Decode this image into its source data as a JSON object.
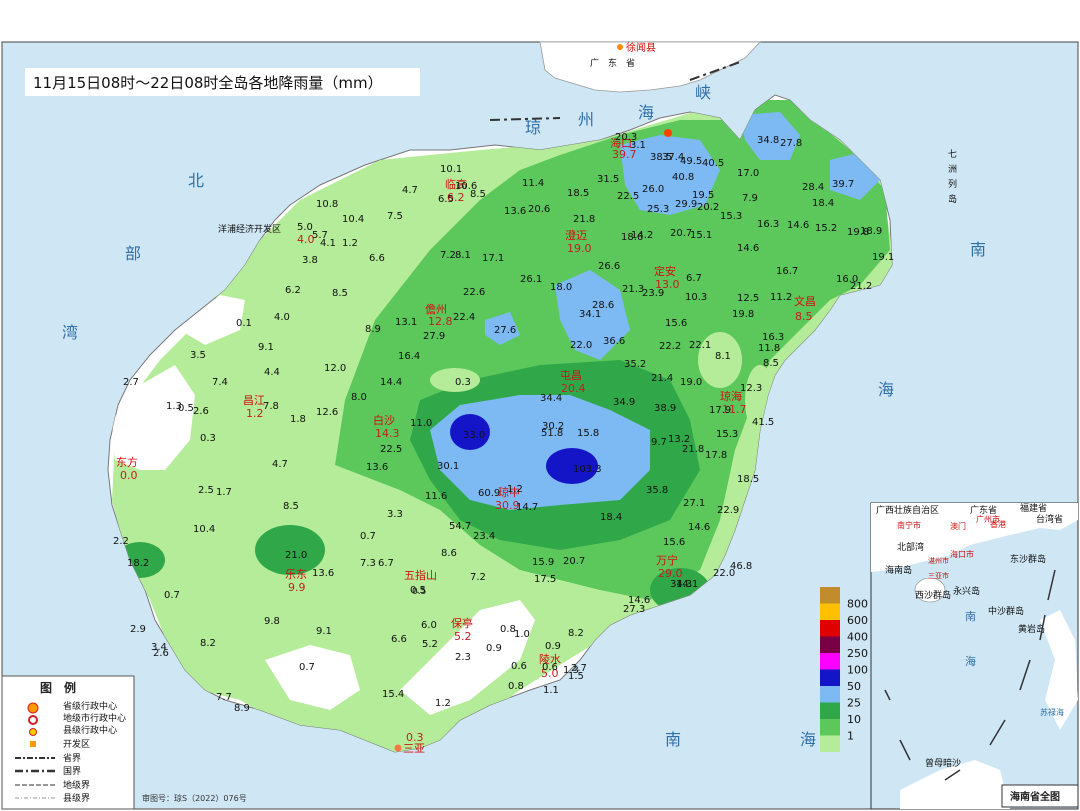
{
  "title": "11月15日08时～22日08时全岛各地降雨量（mm）",
  "colors": {
    "sea": "#cfe6f4",
    "land_outer": "#ffffff",
    "c1": "#b5ec99",
    "c10": "#5cc85c",
    "c25": "#30a84a",
    "c50": "#7db9f3",
    "c100": "#1515c8",
    "c250": "#ff00ff",
    "c400": "#7a0045",
    "c600": "#e00000",
    "c800": "#ffc000",
    "c_top": "#c08c2c"
  },
  "sea_labels": {
    "north_chars": [
      "北",
      "部",
      "湾"
    ],
    "strait_chars": [
      "琼",
      "州",
      "海",
      "峡"
    ],
    "south_chars": [
      "南",
      "海"
    ],
    "east_chars": [
      "南",
      "海"
    ],
    "qizhou": [
      "七",
      "洲",
      "列",
      "岛"
    ],
    "guangdong": "广　东　省"
  },
  "places": {
    "xuwen": "徐闻县",
    "haikou": {
      "name": "海口",
      "value": "39.7"
    },
    "lingao": {
      "name": "临高",
      "value": "6.2"
    },
    "chengmai": {
      "name": "澄迈",
      "value": "19.0"
    },
    "dingan": {
      "name": "定安",
      "value": "13.0"
    },
    "wenchang": {
      "name": "文昌",
      "value": "8.5"
    },
    "danzhou": {
      "name": "儋州",
      "value": "12.8"
    },
    "yangpu": {
      "name": "洋浦经济开发区",
      "value": "4.0"
    },
    "changjiang": {
      "name": "昌江",
      "value": "1.2"
    },
    "baisha": {
      "name": "白沙",
      "value": "14.3"
    },
    "tunchang": {
      "name": "屯昌",
      "value": "20.4"
    },
    "qionghai": {
      "name": "琼海",
      "value": "11.7"
    },
    "dongfang": {
      "name": "东方",
      "value": "0.0"
    },
    "qiongzhong": {
      "name": "琼中",
      "value": "30.9"
    },
    "ledong": {
      "name": "乐东",
      "value": "9.9"
    },
    "wuzhishan": {
      "name": "五指山",
      "value": "0.5"
    },
    "baoting": {
      "name": "保亭",
      "value": "5.2"
    },
    "wanning": {
      "name": "万宁",
      "value": "29.0"
    },
    "lingshui": {
      "name": "陵水",
      "value": "5.0"
    },
    "sanya": {
      "name": "三亚",
      "value": "0.3"
    }
  },
  "station_values": [
    "20.3",
    "3.1",
    "38.5",
    "37.4",
    "49.5",
    "40.5",
    "34.8",
    "27.8",
    "28.4",
    "39.7",
    "10.1",
    "10.6",
    "6.5",
    "8.5",
    "4.7",
    "11.4",
    "18.5",
    "31.5",
    "26.0",
    "40.8",
    "19.5",
    "17.0",
    "18.4",
    "10.8",
    "10.4",
    "7.5",
    "13.6",
    "20.6",
    "21.8",
    "22.5",
    "25.3",
    "29.9",
    "20.2",
    "15.3",
    "7.9",
    "16.3",
    "14.6",
    "15.2",
    "19.8",
    "18.9",
    "19.1",
    "5.0",
    "5.7",
    "4.1",
    "1.2",
    "3.8",
    "6.6",
    "7.2",
    "8.1",
    "17.1",
    "18.6",
    "14.2",
    "20.7",
    "15.1",
    "14.6",
    "26.1",
    "18.0",
    "26.6",
    "21.3",
    "23.9",
    "6.7",
    "16.7",
    "16.0",
    "21.2",
    "6.2",
    "8.5",
    "22.6",
    "10.3",
    "12.5",
    "11.2",
    "0.1",
    "4.0",
    "13.1",
    "22.4",
    "27.6",
    "28.6",
    "34.1",
    "15.6",
    "19.8",
    "9.1",
    "8.9",
    "27.9",
    "22.0",
    "36.6",
    "22.2",
    "22.1",
    "11.8",
    "16.3",
    "3.5",
    "16.4",
    "35.2",
    "8.1",
    "8.5",
    "7.4",
    "4.4",
    "12.0",
    "14.4",
    "0.3",
    "21.4",
    "19.0",
    "12.3",
    "2.7",
    "7.8",
    "8.0",
    "34.4",
    "34.9",
    "17.9",
    "41.5",
    "1.3",
    "0.5",
    "2.6",
    "0.3",
    "1.8",
    "12.6",
    "11.0",
    "33.0",
    "30.2",
    "51.8",
    "15.8",
    "38.9",
    "15.3",
    "22.5",
    "9.7",
    "13.2",
    "21.8",
    "17.8",
    "4.7",
    "13.6",
    "30.1",
    "103.3",
    "18.5",
    "2.5",
    "1.7",
    "11.6",
    "60.9",
    "1.2",
    "14.7",
    "35.8",
    "27.1",
    "8.5",
    "3.3",
    "54.7",
    "18.4",
    "22.9",
    "10.4",
    "0.7",
    "23.4",
    "14.6",
    "2.2",
    "21.0",
    "15.9",
    "20.7",
    "15.6",
    "18.2",
    "7.3",
    "6.7",
    "8.6",
    "7.2",
    "17.5",
    "22.0",
    "46.8",
    "0.7",
    "13.6",
    "0.5",
    "34.3",
    "14.1",
    "2.9",
    "9.8",
    "6.0",
    "14.6",
    "27.3",
    "3.4",
    "2.6",
    "8.2",
    "9.1",
    "6.6",
    "5.2",
    "0.8",
    "1.0",
    "0.9",
    "8.2",
    "0.7",
    "2.3",
    "0.9",
    "0.6",
    "1.3",
    "2.7",
    "0.6",
    "1.5",
    "7.7",
    "8.9",
    "15.4",
    "1.2",
    "0.8",
    "1.1"
  ],
  "legend_scale": {
    "labels": [
      "800",
      "600",
      "400",
      "250",
      "100",
      "50",
      "25",
      "10",
      "1"
    ]
  },
  "legend_box": {
    "title": "图　例",
    "items": [
      "省级行政中心",
      "地级市行政中心",
      "县级行政中心",
      "开发区",
      "省界",
      "国界",
      "地级界",
      "县级界"
    ]
  },
  "inset": {
    "title": "海南省全图",
    "labels": [
      "广西壮族自治区",
      "广东省",
      "福建省",
      "台湾省",
      "南宁市",
      "广州市",
      "澳门",
      "香港",
      "海口市",
      "北部湾",
      "海南岛",
      "湛州市",
      "三亚市",
      "西沙群岛",
      "永兴岛",
      "东沙群岛",
      "中沙群岛",
      "黄岩岛",
      "南",
      "海",
      "苏禄海",
      "曾母暗沙"
    ]
  },
  "credit": "审图号：琼S（2022）076号"
}
